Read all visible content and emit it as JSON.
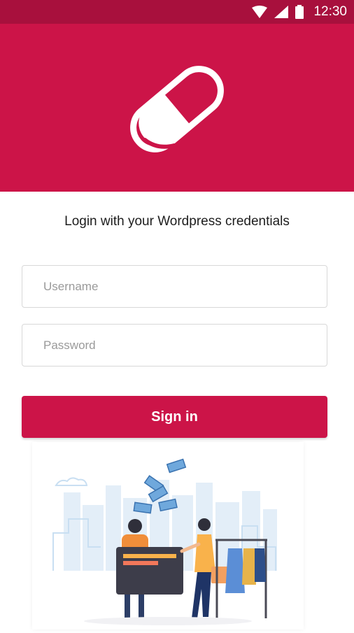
{
  "status_bar": {
    "time": "12:30",
    "icons": [
      "wifi-icon",
      "signal-icon",
      "battery-icon"
    ]
  },
  "hero": {
    "logo": "pill-capsule-icon"
  },
  "login": {
    "heading": "Login with your Wordpress credentials",
    "username_placeholder": "Username",
    "password_placeholder": "Password",
    "signin_label": "Sign in"
  },
  "illustration": {
    "name": "shopping-payment-illustration"
  },
  "colors": {
    "status_bar": "#a8103d",
    "primary": "#cc1448",
    "text": "#1d1d1d",
    "placeholder": "#9a9a9a"
  }
}
